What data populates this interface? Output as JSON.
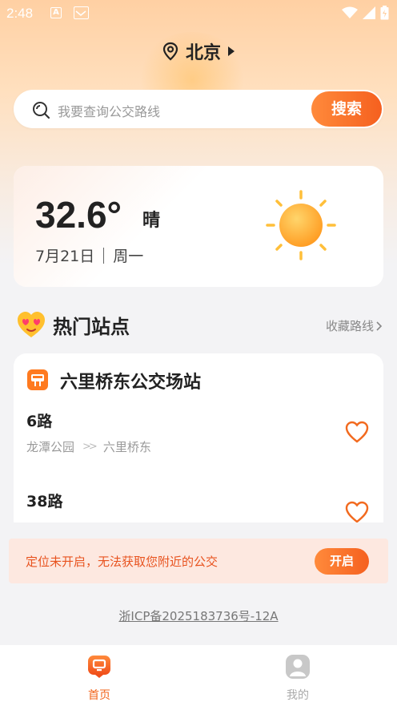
{
  "status_bar": {
    "time": "2:48",
    "notif_a": "A"
  },
  "location": {
    "city": "北京"
  },
  "search": {
    "placeholder": "我要查询公交路线",
    "button_label": "搜索"
  },
  "weather": {
    "temperature": "32.6°",
    "condition": "晴",
    "date": "7月21日",
    "weekday": "周一"
  },
  "hot_stations": {
    "title": "热门站点",
    "link_label": "收藏路线",
    "station": {
      "name": "六里桥东公交场站",
      "routes": [
        {
          "name": "6路",
          "from": "龙潭公园",
          "to": "六里桥东"
        },
        {
          "name": "38路",
          "from": "",
          "to": ""
        }
      ]
    }
  },
  "location_banner": {
    "message": "定位未开启，无法获取您附近的公交",
    "button_label": "开启"
  },
  "footer": {
    "icp": "浙ICP备2025183736号-12A"
  },
  "tab_bar": {
    "home_label": "首页",
    "me_label": "我的"
  },
  "colors": {
    "accent": "#f5601f",
    "accent_light": "#ff8a3b",
    "banner_bg": "#fde8e0"
  }
}
